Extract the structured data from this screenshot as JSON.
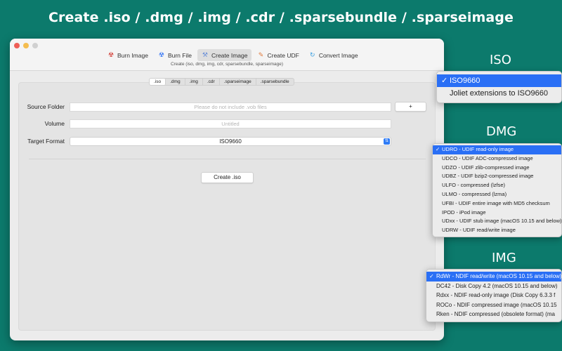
{
  "headline": "Create .iso / .dmg / .img / .cdr / .sparsebundle / .sparseimage",
  "labels": {
    "iso": "ISO",
    "dmg": "DMG",
    "img": "IMG"
  },
  "toolbar": [
    {
      "label": "Burn Image",
      "icon": "☢"
    },
    {
      "label": "Burn File",
      "icon": "☢"
    },
    {
      "label": "Create Image",
      "icon": "⚒"
    },
    {
      "label": "Create UDF",
      "icon": "✎"
    },
    {
      "label": "Convert Image",
      "icon": "↻"
    }
  ],
  "subtitle": "Create (iso,  dmg,  img,  cdr,  sparsebundle,  sparseimage)",
  "tabs": [
    ".iso",
    ".dmg",
    ".img",
    ".cdr",
    ".sparseimage",
    ".sparsebundle"
  ],
  "form": {
    "source_label": "Source Folder",
    "source_placeholder": "Please do not include .vob files",
    "add_label": "+",
    "volume_label": "Volume",
    "volume_placeholder": "Untitled",
    "format_label": "Target Format",
    "format_value": "ISO9660",
    "format_arrow": "⇅",
    "create_label": "Create .iso"
  },
  "check": "✓",
  "iso_menu": [
    "ISO9660",
    "Joliet extensions to ISO9660"
  ],
  "dmg_menu": [
    "UDRO - UDIF read-only image",
    "UDCO - UDIF ADC-compressed image",
    "UDZO - UDIF zlib-compressed image",
    "UDBZ - UDIF bzip2-compressed image",
    "ULFO - compressed (lzfse)",
    "ULMO - compressed (lzma)",
    "UFBI - UDIF entire image with MD5 checksum",
    "IPOD - iPod image",
    "UDxx - UDIF stub image (macOS 10.15 and below)",
    "UDRW - UDIF read/write image"
  ],
  "img_menu": [
    "RdWr - NDIF read/write (macOS 10.15 and below)",
    "DC42 - Disk Copy 4.2 (macOS 10.15 and below)",
    "Rdxx - NDIF read-only image (Disk Copy 6.3.3 f",
    "ROCo - NDIF compressed image (macOS 10.15",
    "Rken - NDIF compressed (obsolete format) (ma"
  ],
  "colors": {
    "background": "#0c7a6c",
    "accent": "#2a6ff5"
  }
}
